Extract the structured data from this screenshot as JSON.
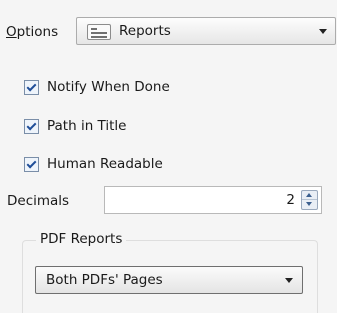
{
  "options": {
    "label_hotkey": "O",
    "label_rest": "ptions",
    "selected": "Reports",
    "icon": "document-icon"
  },
  "checkboxes": [
    {
      "label": "Notify When Done",
      "checked": true
    },
    {
      "label": "Path in Title",
      "checked": true
    },
    {
      "label": "Human Readable",
      "checked": true
    }
  ],
  "decimals": {
    "label": "Decimals",
    "value": "2"
  },
  "pdf_reports": {
    "title": "PDF Reports",
    "selected": "Both PDFs' Pages"
  }
}
